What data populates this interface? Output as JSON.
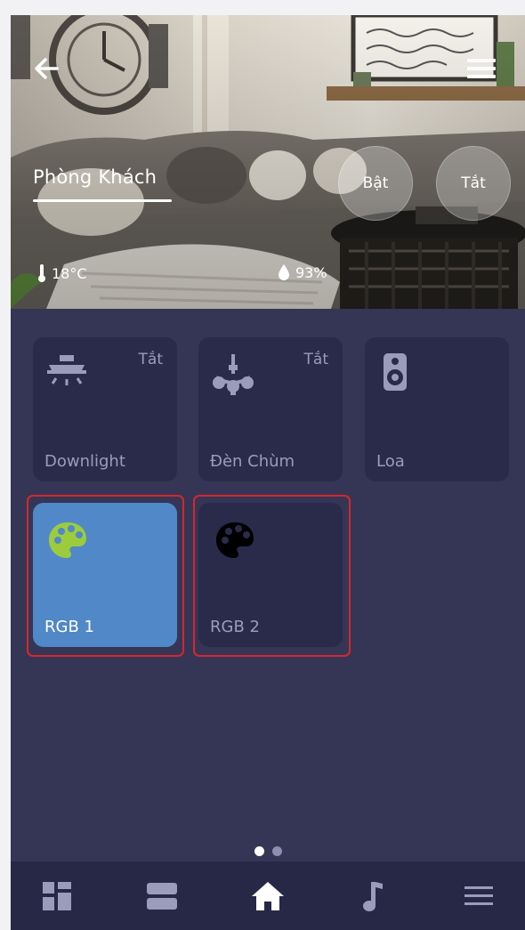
{
  "header": {
    "room_title": "Phòng Khách",
    "on_label": "Bật",
    "off_label": "Tắt",
    "temperature": "18°C",
    "humidity": "93%"
  },
  "devices": [
    {
      "label": "Downlight",
      "state": "Tắt",
      "icon": "downlight-icon"
    },
    {
      "label": "Đèn Chùm",
      "state": "Tắt",
      "icon": "chandelier-icon"
    },
    {
      "label": "Loa",
      "state": "",
      "icon": "speaker-icon"
    },
    {
      "label": "RGB 1",
      "state": "",
      "icon": "palette-icon",
      "active": true,
      "icon_color": "#9ccc3c"
    },
    {
      "label": "RGB 2",
      "state": "",
      "icon": "palette-icon",
      "active": false,
      "icon_color": "#000000"
    }
  ],
  "pager": {
    "pages": 2,
    "current": 1
  },
  "bottom_nav": [
    {
      "icon": "dashboard-icon"
    },
    {
      "icon": "rooms-icon"
    },
    {
      "icon": "home-icon",
      "active": true
    },
    {
      "icon": "music-icon"
    },
    {
      "icon": "menu-icon"
    }
  ],
  "colors": {
    "background": "#353655",
    "tile": "#2a2b4a",
    "tile_active": "#5088c8",
    "highlight": "#d8262c",
    "nav": "#272846"
  }
}
